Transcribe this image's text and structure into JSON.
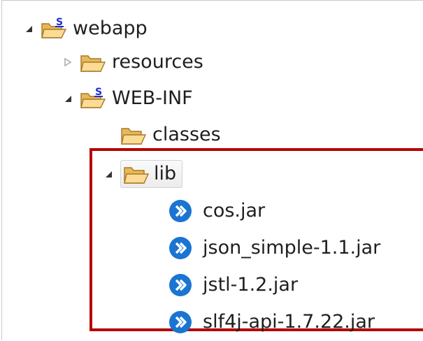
{
  "tree": {
    "items": [
      {
        "label": "webapp",
        "icon": "source-folder-icon"
      },
      {
        "label": "resources",
        "icon": "folder-icon"
      },
      {
        "label": "WEB-INF",
        "icon": "source-folder-icon"
      },
      {
        "label": "classes",
        "icon": "folder-icon"
      },
      {
        "label": "lib",
        "icon": "folder-icon"
      },
      {
        "label": "cos.jar",
        "icon": "jar-icon"
      },
      {
        "label": "json_simple-1.1.jar",
        "icon": "jar-icon"
      },
      {
        "label": "jstl-1.2.jar",
        "icon": "jar-icon"
      },
      {
        "label": "slf4j-api-1.7.22.jar",
        "icon": "jar-icon"
      }
    ],
    "source_badge": "S"
  },
  "colors": {
    "highlight": "#b50000",
    "jar": "#1a74d1",
    "folder": "#f2c46b",
    "badge": "#1a2fd0"
  }
}
